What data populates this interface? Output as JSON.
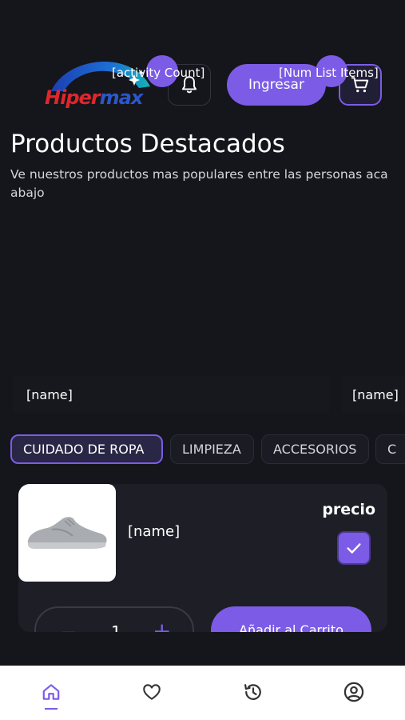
{
  "header": {
    "logo_text_a": "Hiper",
    "logo_text_b": "max",
    "activity_badge": "[activity Count]",
    "cart_badge": "[Num List Items]",
    "login_label": "Ingresar"
  },
  "featured": {
    "title": "Productos Destacados",
    "subtitle": "Ve nuestros productos mas populares entre las personas aca abajo",
    "items": [
      {
        "name": "[name]"
      },
      {
        "name": "[name]"
      }
    ]
  },
  "categories": {
    "items": [
      {
        "label": "CUIDADO DE ROPA",
        "active": true
      },
      {
        "label": "LIMPIEZA",
        "active": false
      },
      {
        "label": "ACCESORIOS",
        "active": false
      },
      {
        "label": "C",
        "active": false
      }
    ]
  },
  "product": {
    "name": "[name]",
    "price_label": "precio",
    "quantity": "1",
    "minus": "−",
    "plus": "+",
    "add_to_cart_label": "Añadir al Carrito"
  },
  "bottom_nav": {
    "items": [
      {
        "icon": "home-icon",
        "active": true
      },
      {
        "icon": "heart-icon",
        "active": false
      },
      {
        "icon": "history-icon",
        "active": false
      },
      {
        "icon": "user-circle-icon",
        "active": false
      }
    ]
  },
  "colors": {
    "background": "#15151c",
    "accent": "#7c5ce6",
    "card": "#1e1e27",
    "nav_bg": "#ffffff"
  }
}
